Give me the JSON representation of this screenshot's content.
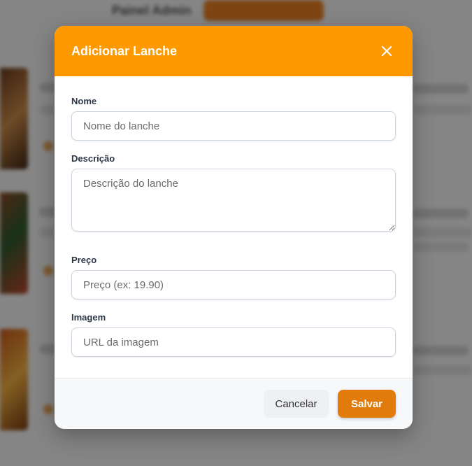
{
  "background": {
    "header_text": "Painel Admin",
    "header_button": ""
  },
  "modal": {
    "title": "Adicionar Lanche",
    "close_icon": "close-icon",
    "fields": {
      "name": {
        "label": "Nome",
        "placeholder": "Nome do lanche",
        "value": ""
      },
      "description": {
        "label": "Descrição",
        "placeholder": "Descrição do lanche",
        "value": ""
      },
      "price": {
        "label": "Preço",
        "placeholder": "Preço (ex: 19.90)",
        "value": ""
      },
      "image": {
        "label": "Imagem",
        "placeholder": "URL da imagem",
        "value": ""
      }
    },
    "footer": {
      "cancel_label": "Cancelar",
      "save_label": "Salvar"
    }
  },
  "colors": {
    "header": "#ff9900",
    "save_button": "#e07b0c",
    "overlay": "rgba(0,0,0,0.45)"
  }
}
